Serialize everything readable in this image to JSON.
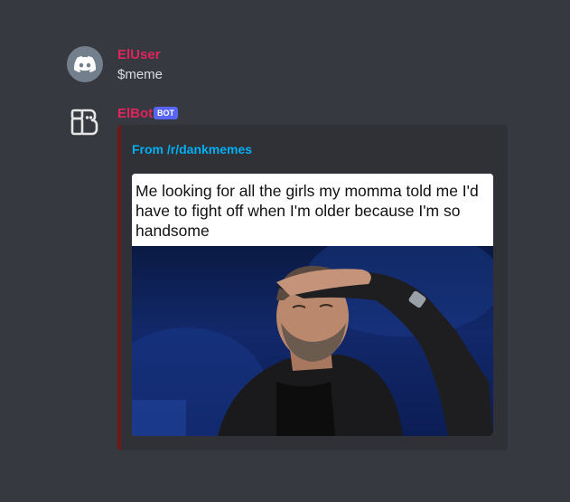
{
  "messages": [
    {
      "author": "ElUser",
      "text": "$meme",
      "avatar_icon": "discord-logo-icon"
    },
    {
      "author": "ElBot",
      "badge": "BOT",
      "avatar_icon": "bot-avatar-icon",
      "embed": {
        "title": "From /r/dankmemes",
        "accent_color": "#6f1a15",
        "image": {
          "caption": "Me looking for all the girls my momma told me I'd have to fight off when I'm older because I'm so handsome",
          "photo_icon": "man-shielding-eyes-photo"
        }
      }
    }
  ],
  "colors": {
    "background": "#36393f",
    "username": "#e0245e",
    "embed_bg": "#2f3136",
    "embed_title": "#00aff4",
    "badge": "#5865f2"
  }
}
